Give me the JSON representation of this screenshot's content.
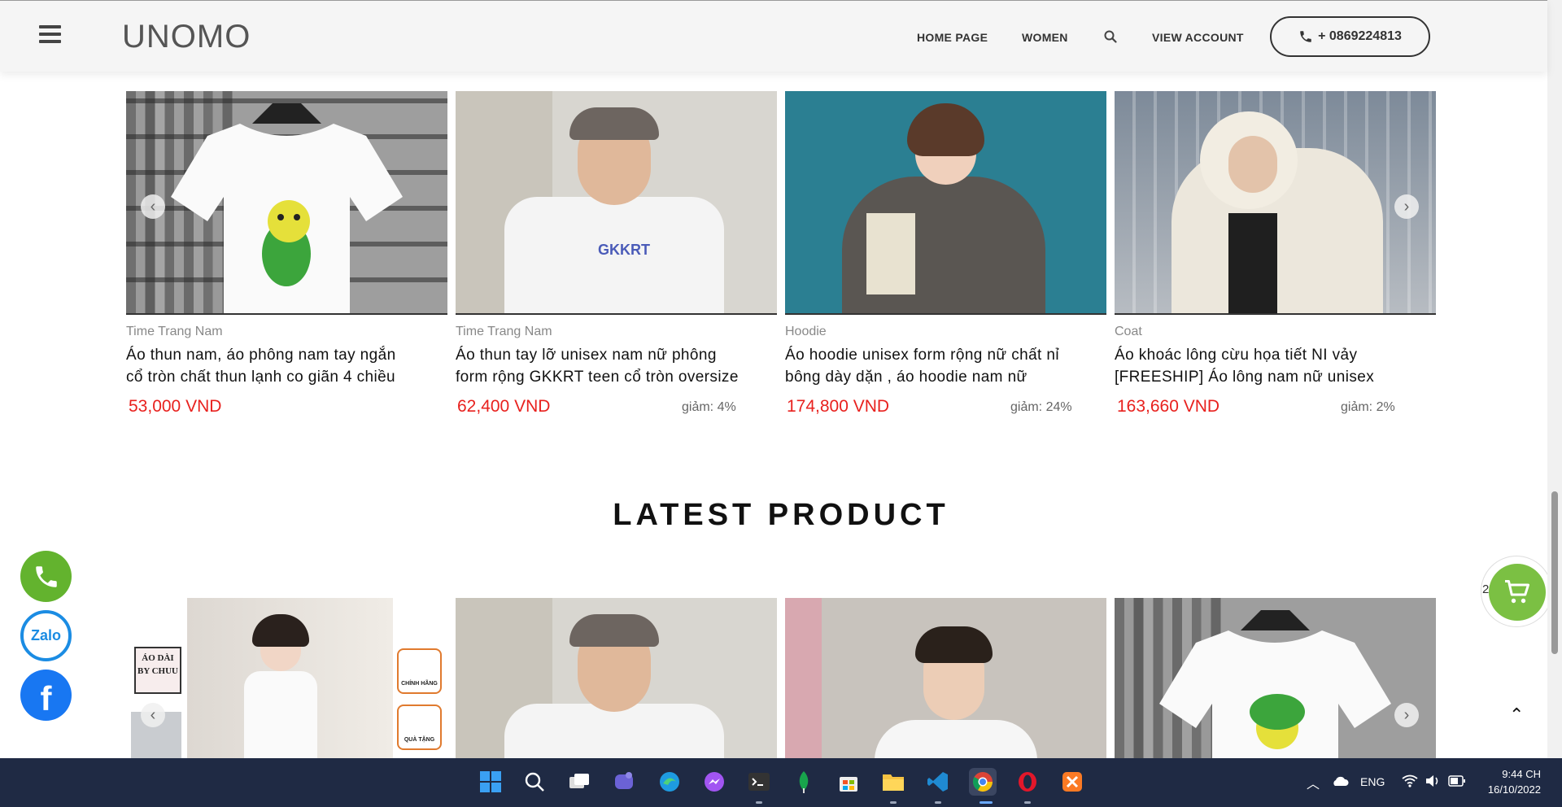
{
  "header": {
    "logo": "UNOMO",
    "nav": [
      "HOME PAGE",
      "WOMEN",
      "VIEW ACCOUNT"
    ],
    "phone": "+ 0869224813"
  },
  "top_products": [
    {
      "category": "Time Trang Nam",
      "title_1": "Áo thun nam, áo phông nam tay ngắn",
      "title_2": "cổ tròn chất thun lạnh co giãn 4 chiều",
      "price": "53,000 VND",
      "discount": ""
    },
    {
      "category": "Time Trang Nam",
      "title_1": "Áo thun tay lỡ unisex nam nữ phông",
      "title_2": "form rộng GKKRT teen cổ tròn oversize",
      "price": "62,400 VND",
      "discount": "giảm: 4%"
    },
    {
      "category": "Hoodie",
      "title_1": "Áo hoodie unisex form rộng nữ chất nỉ",
      "title_2": "bông dày dặn , áo hoodie nam nữ",
      "price": "174,800 VND",
      "discount": "giảm: 24%"
    },
    {
      "category": "Coat",
      "title_1": "Áo khoác lông cừu họa tiết NI vảy",
      "title_2": "[FREESHIP] Áo lông nam nữ unisex",
      "price": "163,660 VND",
      "discount": "giảm: 2%"
    }
  ],
  "section": {
    "latest_title": "LATEST PRODUCT"
  },
  "latest_banner": {
    "badge": "ÁO DÀI BY CHUU",
    "tag_1": "CHÍNH HÃNG",
    "tag_2": "QUÀ TẶNG"
  },
  "floating": {
    "zalo": "Zalo",
    "cart_count": "2"
  },
  "taskbar": {
    "lang": "ENG",
    "time": "9:44 CH",
    "date": "16/10/2022"
  },
  "colors": {
    "price": "#e8211e",
    "accent_green": "#7bc043",
    "taskbar": "#1f2a44"
  }
}
